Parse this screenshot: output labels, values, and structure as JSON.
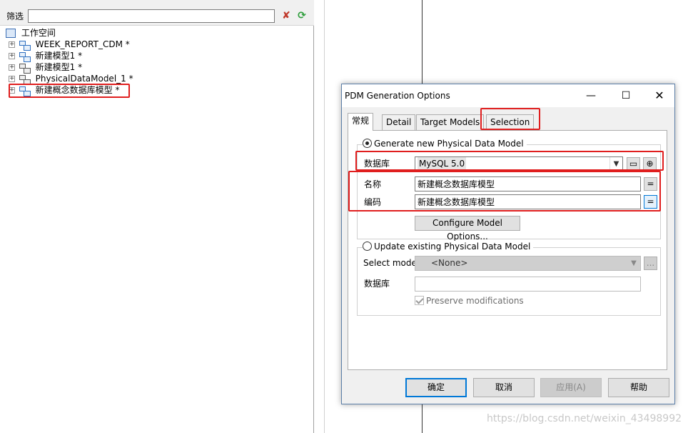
{
  "browser": {
    "filter_label": "筛选",
    "filter_value": "",
    "tree": {
      "root_label": "工作空间",
      "items": [
        {
          "label": "WEEK_REPORT_CDM *",
          "icon": "conceptual-model-icon"
        },
        {
          "label": "新建模型1 *",
          "icon": "conceptual-model-icon"
        },
        {
          "label": "新建模型1 *",
          "icon": "physical-model-icon"
        },
        {
          "label": "PhysicalDataModel_1 *",
          "icon": "physical-model-icon"
        },
        {
          "label": "新建概念数据库模型 *",
          "icon": "conceptual-model-icon"
        }
      ]
    }
  },
  "dialog": {
    "title": "PDM Generation Options",
    "window_buttons": {
      "minimize": "—",
      "maximize": "☐",
      "close": "✕"
    },
    "tabs": [
      "常规",
      "Detail",
      "Target Models",
      "Selection"
    ],
    "active_tab": "常规",
    "generate_new": {
      "radio_label": "Generate new Physical Data Model",
      "checked": true,
      "dbms_label": "数据库",
      "dbms_value": "MySQL 5.0",
      "name_label": "名称",
      "name_value": "新建概念数据库模型",
      "code_label": "编码",
      "code_value": "新建概念数据库模型",
      "equals_symbol": "=",
      "configure_button": "Configure Model Options..."
    },
    "update_existing": {
      "radio_label": "Update existing Physical Data Model",
      "checked": false,
      "select_model_label": "Select model:",
      "select_model_value": "<None>",
      "dbms_label": "数据库",
      "dbms_value": "",
      "preserve_label": "Preserve modifications",
      "preserve_checked": true,
      "ellipsis": "..."
    },
    "footer": {
      "ok": "确定",
      "cancel": "取消",
      "apply": "应用(A)",
      "help": "帮助"
    }
  },
  "watermark": "https://blog.csdn.net/weixin_43498992",
  "colors": {
    "highlight": "#e01e1e",
    "accent": "#0078d7"
  }
}
